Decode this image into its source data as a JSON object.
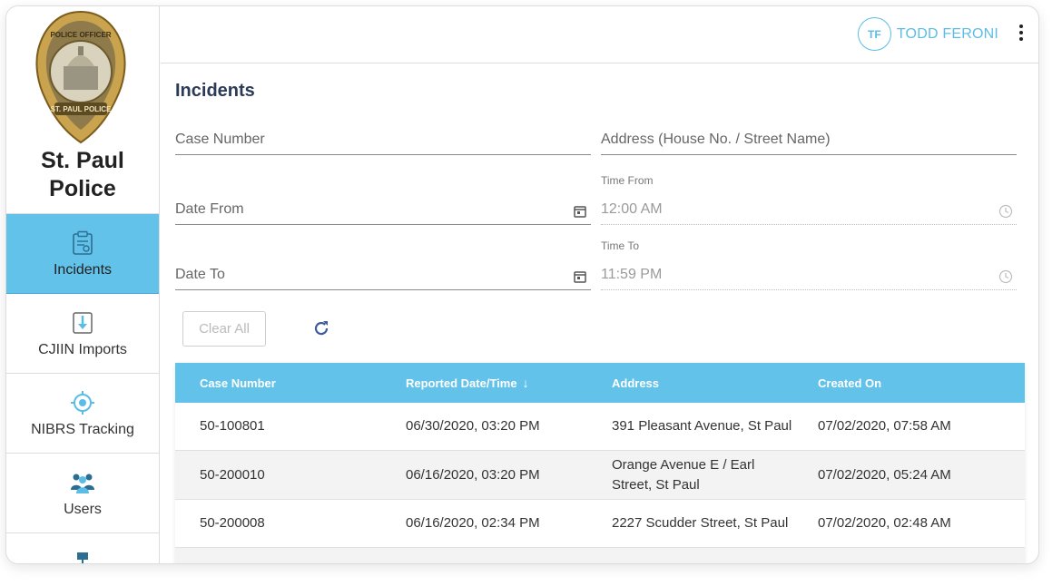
{
  "sidebar": {
    "brand": "St. Paul Police",
    "badge": {
      "top_text": "POLICE OFFICER",
      "bottom_text": "ST. PAUL POLICE"
    },
    "items": [
      {
        "label": "Incidents",
        "icon": "incident-clipboard-icon",
        "active": true
      },
      {
        "label": "CJIIN Imports",
        "icon": "import-icon",
        "active": false
      },
      {
        "label": "NIBRS Tracking",
        "icon": "target-icon",
        "active": false
      },
      {
        "label": "Users",
        "icon": "users-icon",
        "active": false
      }
    ]
  },
  "header": {
    "avatar_initials": "TF",
    "user_name": "TODD FERONI",
    "menu_icon": "kebab-menu-icon"
  },
  "main": {
    "title": "Incidents",
    "filters": {
      "case_number": "Case Number",
      "address": "Address (House No. / Street Name)",
      "date_from": "Date From",
      "time_from_label": "Time From",
      "time_from_value": "12:00 AM",
      "date_to": "Date To",
      "time_to_label": "Time To",
      "time_to_value": "11:59 PM"
    },
    "clear_all": "Clear All",
    "refresh_icon": "refresh-icon"
  },
  "table": {
    "columns": [
      "Case Number",
      "Reported Date/Time",
      "Address",
      "Created On"
    ],
    "sort_column": "Reported Date/Time",
    "rows": [
      [
        "50-100801",
        "06/30/2020, 03:20 PM",
        "391 Pleasant Avenue, St Paul",
        "07/02/2020, 07:58 AM"
      ],
      [
        "50-200010",
        "06/16/2020, 03:20 PM",
        "Orange Avenue E / Earl Street, St Paul",
        "07/02/2020, 05:24 AM"
      ],
      [
        "50-200008",
        "06/16/2020, 02:34 PM",
        "2227 Scudder Street, St Paul",
        "07/02/2020, 02:48 AM"
      ]
    ]
  },
  "colors": {
    "accent": "#62c2ea",
    "title": "#2b3a57",
    "user": "#5bbde6"
  }
}
